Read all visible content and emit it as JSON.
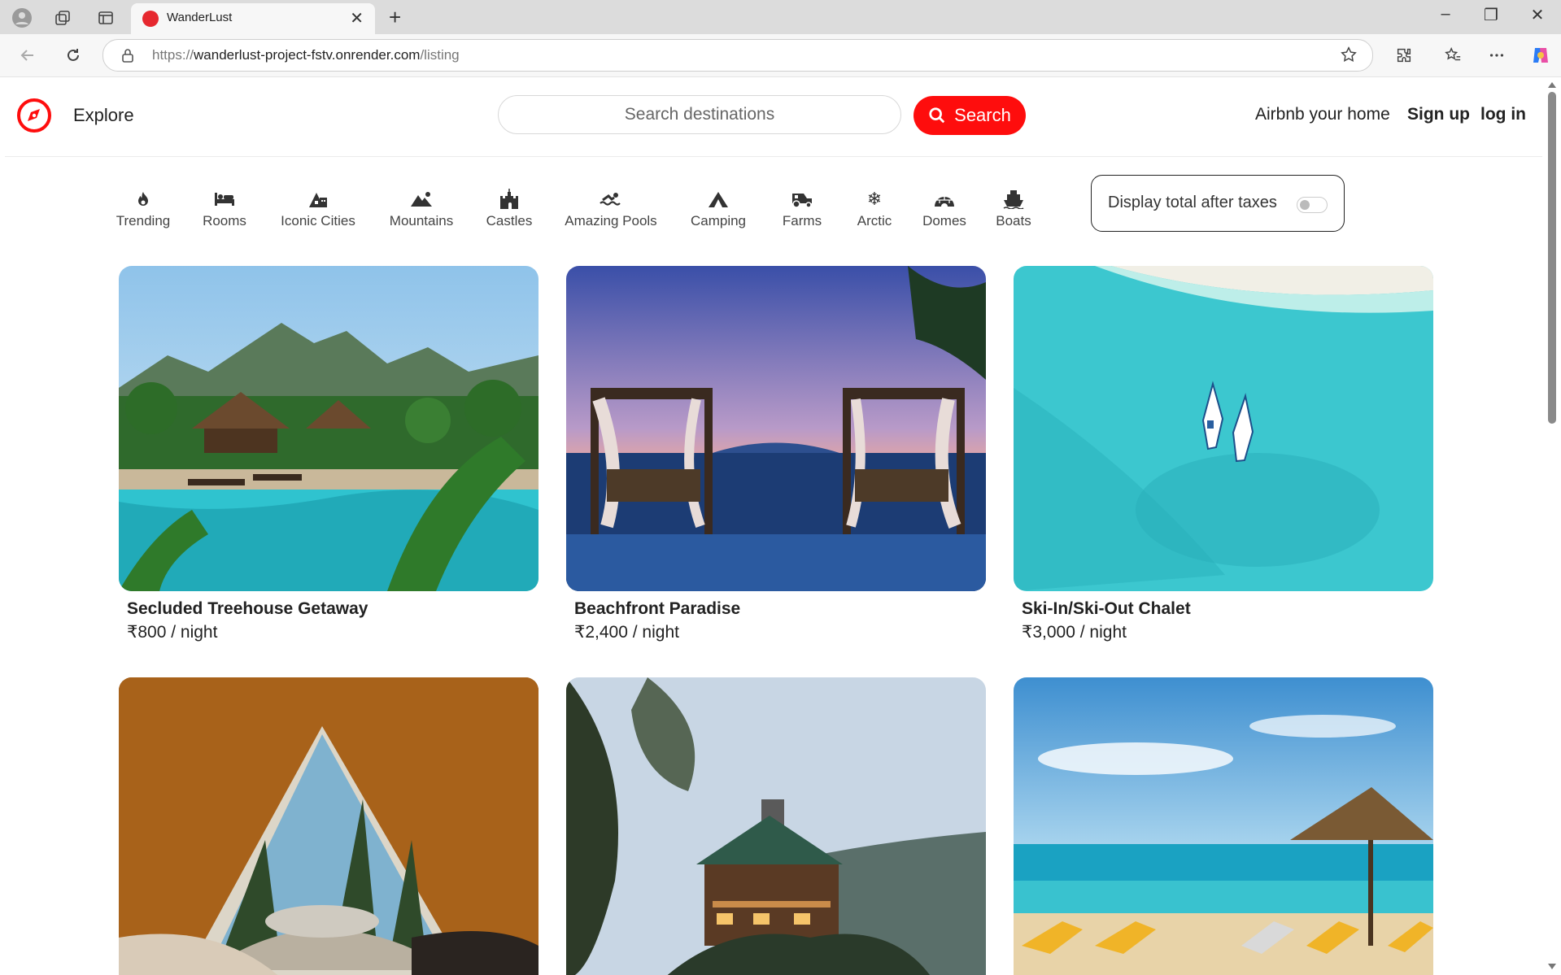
{
  "browser": {
    "tab_title": "WanderLust",
    "url_scheme": "https://",
    "url_host": "wanderlust-project-fstv.onrender.com",
    "url_path": "/listing"
  },
  "navbar": {
    "explore": "Explore",
    "search_placeholder": "Search destinations",
    "search_button": "Search",
    "airbnb_home": "Airbnb your home",
    "signup": "Sign up",
    "login": "log in",
    "brand_color": "#fe0d0d"
  },
  "filters": [
    {
      "label": "Trending",
      "icon": "fire-icon"
    },
    {
      "label": "Rooms",
      "icon": "bed-icon"
    },
    {
      "label": "Iconic Cities",
      "icon": "city-icon"
    },
    {
      "label": "Mountains",
      "icon": "mountain-icon"
    },
    {
      "label": "Castles",
      "icon": "castle-icon"
    },
    {
      "label": "Amazing Pools",
      "icon": "swimmer-icon"
    },
    {
      "label": "Camping",
      "icon": "tent-icon"
    },
    {
      "label": "Farms",
      "icon": "tractor-icon"
    },
    {
      "label": "Arctic",
      "icon": "snowflake-icon"
    },
    {
      "label": "Domes",
      "icon": "igloo-icon"
    },
    {
      "label": "Boats",
      "icon": "ship-icon"
    }
  ],
  "tax_toggle": {
    "label": "Display total after taxes",
    "checked": false
  },
  "listings": [
    {
      "title": "Secluded Treehouse Getaway",
      "price": "₹800 / night"
    },
    {
      "title": "Beachfront Paradise",
      "price": "₹2,400 / night"
    },
    {
      "title": "Ski-In/Ski-Out Chalet",
      "price": "₹3,000 / night"
    },
    {
      "title": "",
      "price": ""
    },
    {
      "title": "",
      "price": ""
    },
    {
      "title": "",
      "price": ""
    }
  ]
}
